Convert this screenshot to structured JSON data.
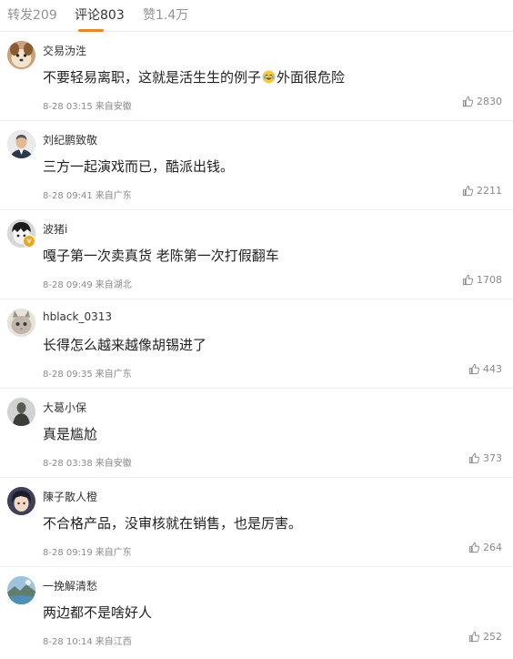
{
  "tabs": {
    "repost": "转发209",
    "comments": "评论803",
    "likes": "赞1.4万",
    "accent": "#ff8200"
  },
  "comments": [
    {
      "user": "交易沩泩",
      "text_before": "不要轻易离职，这就是活生生的例子",
      "emoji": "crying-laughing-emoji",
      "text_after": "外面很危险",
      "time": "8-28 03:15",
      "location": "来自安徽",
      "likes": "2830"
    },
    {
      "user": "刘纪鹏致敬",
      "text_before": "三方一起演戏而已，酷派出钱。",
      "time": "8-28 09:41",
      "location": "来自广东",
      "likes": "2211"
    },
    {
      "user": "波猪i",
      "text_before": "嘎子第一次卖真货 老陈第一次打假翻车",
      "time": "8-28 09:49",
      "location": "来自湖北",
      "likes": "1708"
    },
    {
      "user": "hblack_0313",
      "text_before": "长得怎么越来越像胡锡进了",
      "time": "8-28 09:35",
      "location": "来自广东",
      "likes": "443"
    },
    {
      "user": "大葛小保",
      "text_before": "真是尴尬",
      "time": "8-28 03:38",
      "location": "来自安徽",
      "likes": "373"
    },
    {
      "user": "陳子散人橙",
      "text_before": "不合格产品，没审核就在销售，也是厉害。",
      "time": "8-28 09:19",
      "location": "来自广东",
      "likes": "264"
    },
    {
      "user": "一挽解清愁",
      "text_before": "两边都不是啥好人",
      "time": "8-28 10:14",
      "location": "来自江西",
      "likes": "252"
    }
  ]
}
